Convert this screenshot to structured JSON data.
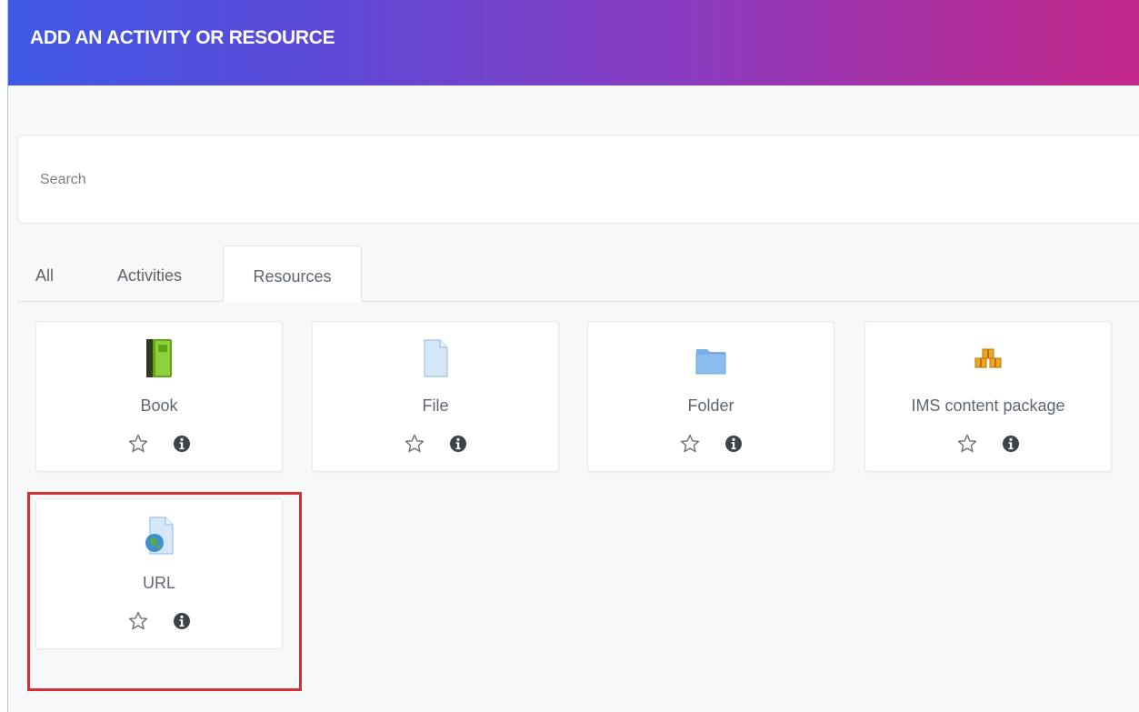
{
  "header": {
    "title": "ADD AN ACTIVITY OR RESOURCE"
  },
  "search": {
    "placeholder": "Search"
  },
  "tabs": [
    {
      "label": "All"
    },
    {
      "label": "Activities"
    },
    {
      "label": "Resources",
      "active": true
    }
  ],
  "resources": [
    {
      "label": "Book",
      "icon": "book-icon"
    },
    {
      "label": "File",
      "icon": "file-icon"
    },
    {
      "label": "Folder",
      "icon": "folder-icon"
    },
    {
      "label": "IMS content package",
      "icon": "package-icon"
    },
    {
      "label": "URL",
      "icon": "url-icon",
      "highlighted": true
    }
  ],
  "colors": {
    "header_gradient_start": "#3f59e4",
    "header_gradient_end": "#c2288a",
    "highlight": "#d12f37"
  }
}
